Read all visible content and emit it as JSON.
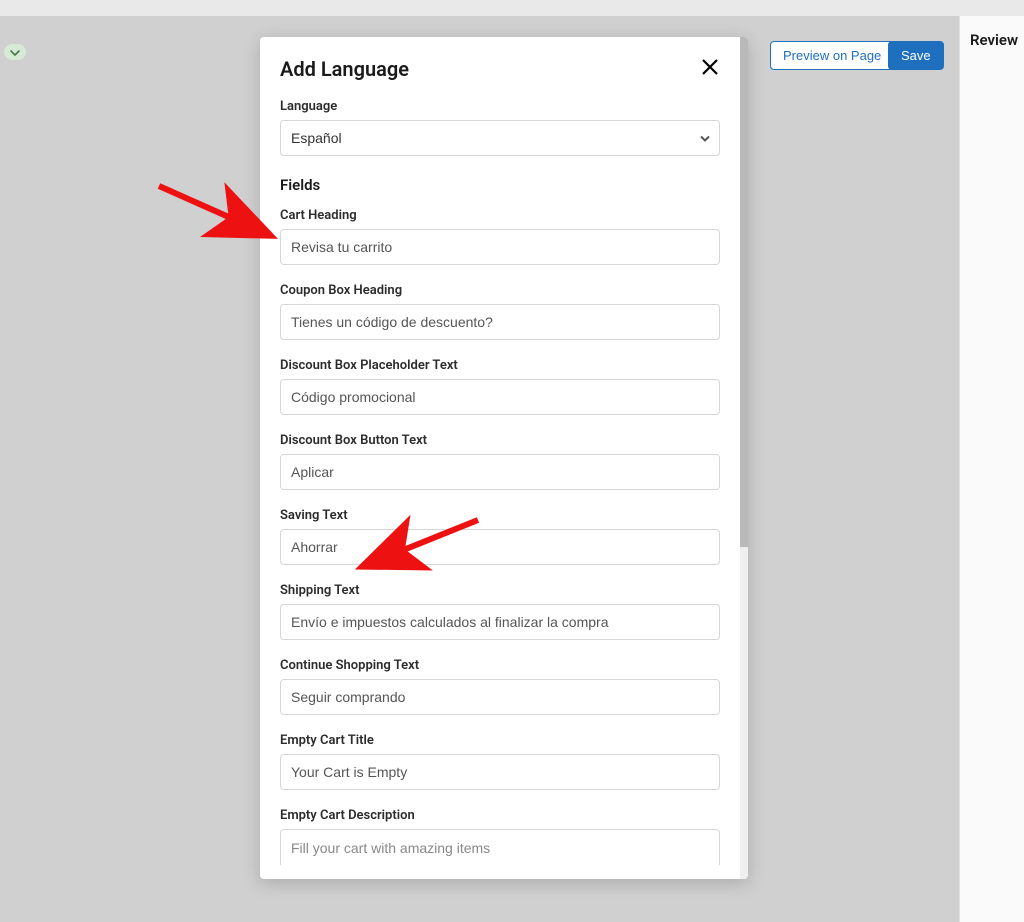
{
  "rightPanel": {
    "title": "Review"
  },
  "header": {
    "previewLabel": "Preview on Page",
    "saveLabel": "Save"
  },
  "modal": {
    "title": "Add Language",
    "languageLabel": "Language",
    "languageValue": "Español",
    "fieldsHeader": "Fields",
    "fields": [
      {
        "label": "Cart Heading",
        "value": "Revisa tu carrito"
      },
      {
        "label": "Coupon Box Heading",
        "value": "Tienes un código de descuento?"
      },
      {
        "label": "Discount Box Placeholder Text",
        "value": "Código promocional"
      },
      {
        "label": "Discount Box Button Text",
        "value": "Aplicar"
      },
      {
        "label": "Saving Text",
        "value": "Ahorrar"
      },
      {
        "label": "Shipping Text",
        "value": "Envío e impuestos calculados al finalizar la compra"
      },
      {
        "label": "Continue Shopping Text",
        "value": "Seguir comprando"
      },
      {
        "label": "Empty Cart Title",
        "value": "Your Cart is Empty"
      },
      {
        "label": "Empty Cart Description",
        "value": "Fill your cart with amazing items"
      }
    ]
  },
  "annotations": {
    "arrowColor": "#e11",
    "arrows": [
      "to-cart-heading",
      "to-saving-text"
    ]
  }
}
